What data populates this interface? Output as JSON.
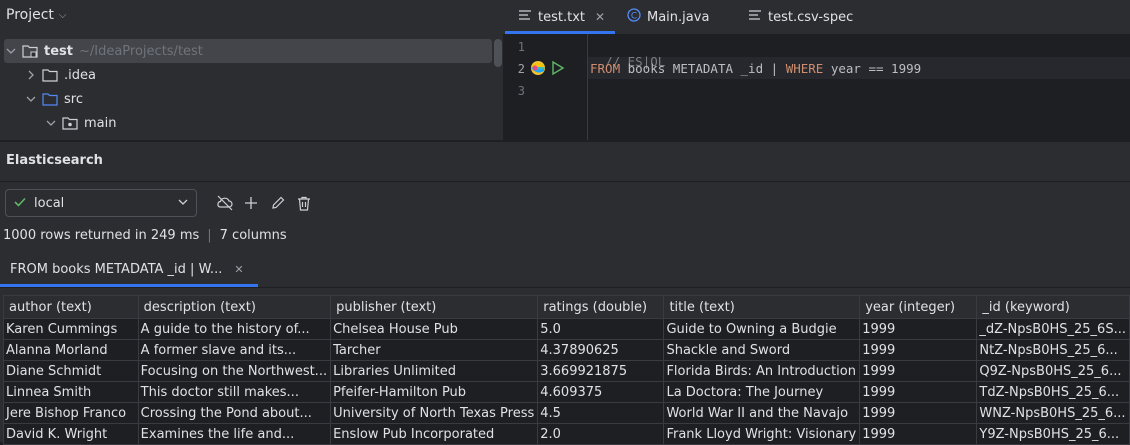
{
  "project": {
    "header": "Project",
    "tree": [
      {
        "name": "test",
        "path": "~/IdeaProjects/test"
      },
      {
        "name": ".idea"
      },
      {
        "name": "src"
      },
      {
        "name": "main"
      }
    ]
  },
  "editor": {
    "tabs": [
      {
        "label": "test.txt",
        "active": true,
        "icon": "text-file-icon"
      },
      {
        "label": "Main.java",
        "icon": "java-class-icon"
      },
      {
        "label": "test.csv-spec",
        "icon": "text-file-icon"
      }
    ],
    "lines": [
      {
        "num": "1",
        "text": "// ES|QL"
      },
      {
        "num": "2",
        "kw1": "FROM",
        "mid": " books METADATA _id | ",
        "kw2": "WHERE",
        "tail": " year == 1999"
      },
      {
        "num": "3",
        "text": ""
      }
    ]
  },
  "elasticsearch": {
    "title": "Elasticsearch",
    "connection": "local",
    "status_rows": "1000 rows returned in 249 ms",
    "status_cols": "7 columns",
    "result_tab": "FROM books METADATA _id | W...",
    "columns": [
      "author (text)",
      "description (text)",
      "publisher (text)",
      "ratings (double)",
      "title (text)",
      "year (integer)",
      "_id (keyword)"
    ],
    "rows": [
      [
        "Karen Cummings",
        "A guide to the history of...",
        "Chelsea House Pub",
        "5.0",
        "Guide to Owning a Budgie",
        "1999",
        "_dZ-NpsB0HS_25_6S..."
      ],
      [
        "Alanna Morland",
        "A former slave and its...",
        "Tarcher",
        "4.37890625",
        "Shackle and Sword",
        "1999",
        "NtZ-NpsB0HS_25_6..."
      ],
      [
        "Diane Schmidt",
        "Focusing on the Northwest...",
        "Libraries Unlimited",
        "3.669921875",
        "Florida Birds: An Introduction",
        "1999",
        "Q9Z-NpsB0HS_25_6..."
      ],
      [
        "Linnea Smith",
        "This doctor still makes...",
        "Pfeifer-Hamilton Pub",
        "4.609375",
        "La Doctora: The Journey",
        "1999",
        "TdZ-NpsB0HS_25_6..."
      ],
      [
        "Jere Bishop Franco",
        "Crossing the Pond about...",
        "University of North Texas Press",
        "4.5",
        "World War II and the Navajo",
        "1999",
        "WNZ-NpsB0HS_25_6..."
      ],
      [
        "David K. Wright",
        "Examines the life and...",
        "Enslow Pub Incorporated",
        "2.0",
        "Frank Lloyd Wright: Visionary",
        "1999",
        "Y9Z-NpsB0HS_25_6..."
      ]
    ]
  },
  "colors": {
    "accent": "#3574f0",
    "keyword": "#cf8e6d",
    "success": "#5fb865"
  }
}
